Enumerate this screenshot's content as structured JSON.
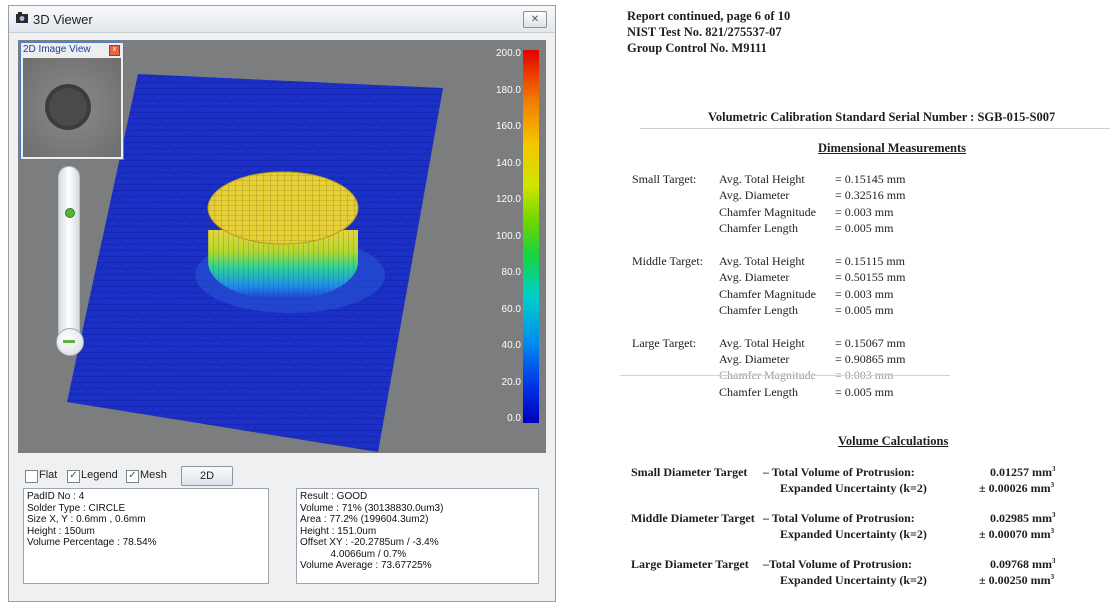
{
  "viewer": {
    "title": "3D Viewer",
    "close_symbol": "✕",
    "thumbnail": {
      "title": "2D Image View",
      "close_symbol": "x"
    },
    "colorbar_labels": [
      "200.0",
      "180.0",
      "160.0",
      "140.0",
      "120.0",
      "100.0",
      "80.0",
      "60.0",
      "40.0",
      "20.0",
      "0.0"
    ],
    "options": {
      "flat": "Flat",
      "legend": "Legend",
      "mesh": "Mesh",
      "button_2d": "2D",
      "flat_checked": false,
      "legend_checked": true,
      "mesh_checked": true
    },
    "pad_info": [
      "PadID No : 4",
      "Solder Type : CIRCLE",
      "Size X, Y : 0.6mm , 0.6mm",
      "Height : 150um",
      "Volume Percentage : 78.54%"
    ],
    "result_info": [
      "Result : GOOD",
      "Volume : 71% (30138830.0um3)",
      "Area : 77.2% (199604.3um2)",
      "Height : 151.0um",
      "Offset XY : -20.2785um / -3.4%",
      "           4.0066um / 0.7%",
      "Volume Average : 73.67725%"
    ],
    "colors": {
      "mesh_base": "#1a2fc6",
      "mesh_lines": "#0d1a80",
      "cylinder": "#e9d23a"
    }
  },
  "report": {
    "header": [
      "Report continued, page 6 of 10",
      "NIST Test No. 821/275537-07",
      "Group Control No. M9111"
    ],
    "serial_title": "Volumetric Calibration Standard Serial Number : SGB-015-S007",
    "dimensional_heading": "Dimensional Measurements",
    "targets": [
      {
        "name": "Small Target:",
        "rows": [
          {
            "label": "Avg. Total Height",
            "value": "= 0.15145 mm"
          },
          {
            "label": "Avg. Diameter",
            "value": "= 0.32516 mm"
          },
          {
            "label": "Chamfer Magnitude",
            "value": "= 0.003 mm"
          },
          {
            "label": "Chamfer Length",
            "value": "= 0.005 mm"
          }
        ]
      },
      {
        "name": "Middle Target:",
        "rows": [
          {
            "label": "Avg. Total Height",
            "value": "= 0.15115 mm"
          },
          {
            "label": "Avg. Diameter",
            "value": "= 0.50155 mm"
          },
          {
            "label": "Chamfer Magnitude",
            "value": "= 0.003 mm"
          },
          {
            "label": "Chamfer Length",
            "value": "= 0.005 mm"
          }
        ]
      },
      {
        "name": "Large Target:",
        "rows": [
          {
            "label": "Avg. Total Height",
            "value": "= 0.15067 mm"
          },
          {
            "label": "Avg. Diameter",
            "value": "= 0.90865 mm"
          },
          {
            "label": "Chamfer Magnitude",
            "value": "= 0.003 mm"
          },
          {
            "label": "Chamfer Length",
            "value": "= 0.005 mm"
          }
        ]
      }
    ],
    "volume_heading": "Volume Calculations",
    "volumes": [
      {
        "name": "Small Diameter Target",
        "line1": "– Total Volume of Protrusion:",
        "value1": "0.01257 mm",
        "line2": "Expanded Uncertainty (k=2)",
        "value2": "± 0.00026 mm"
      },
      {
        "name": "Middle Diameter Target",
        "line1": "– Total Volume of Protrusion:",
        "value1": "0.02985 mm",
        "line2": "Expanded Uncertainty (k=2)",
        "value2": "± 0.00070 mm"
      },
      {
        "name": "Large Diameter Target",
        "line1": "–Total Volume of Protrusion:",
        "value1": "0.09768 mm",
        "line2": "Expanded Uncertainty (k=2)",
        "value2": "± 0.00250 mm"
      }
    ],
    "cube_superscript": "3"
  }
}
